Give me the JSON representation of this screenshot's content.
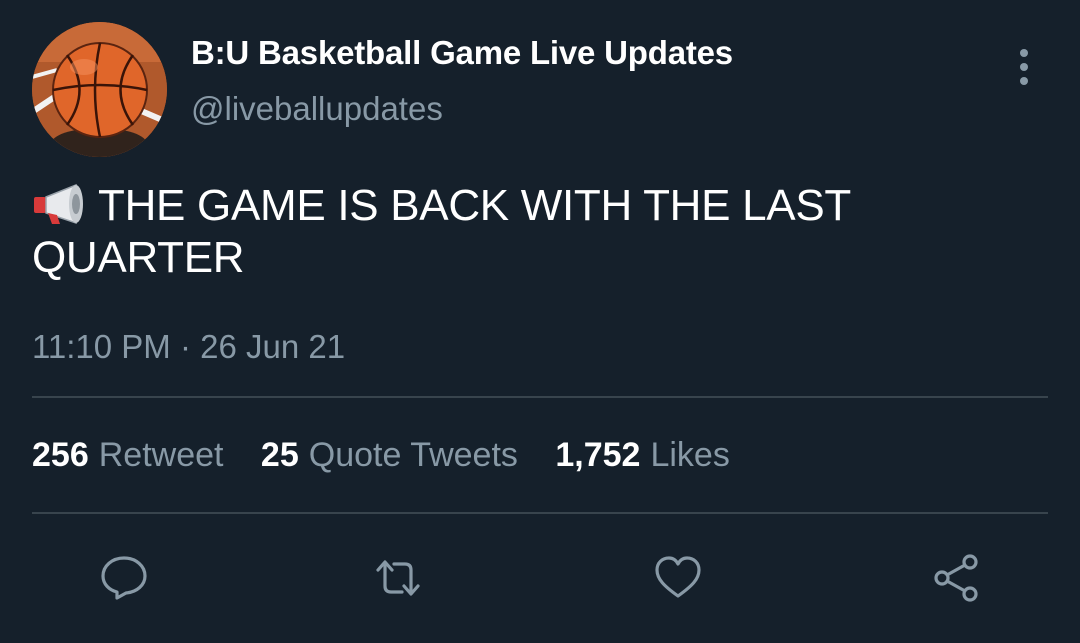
{
  "author": {
    "display_name": "B:U Basketball Game Live Updates",
    "handle": "@liveballupdates",
    "avatar_icon": "basketball-icon"
  },
  "menu": {
    "icon": "more-vertical-icon"
  },
  "tweet": {
    "emoji_icon": "megaphone-icon",
    "text_line1": "THE GAME IS BACK WITH THE LAST",
    "text_line2": "QUARTER"
  },
  "timestamp": {
    "time": "11:10 PM",
    "separator": "·",
    "date": "26 Jun 21"
  },
  "stats": {
    "retweets": {
      "count": "256",
      "label": "Retweet"
    },
    "quotes": {
      "count": "25",
      "label": "Quote Tweets"
    },
    "likes": {
      "count": "1,752",
      "label": "Likes"
    }
  },
  "actions": [
    {
      "icon": "reply-icon"
    },
    {
      "icon": "retweet-icon"
    },
    {
      "icon": "like-icon"
    },
    {
      "icon": "share-icon"
    }
  ],
  "colors": {
    "background": "#15202b",
    "primary_text": "#ffffff",
    "secondary_text": "#8899a6",
    "divider": "#38444d"
  }
}
